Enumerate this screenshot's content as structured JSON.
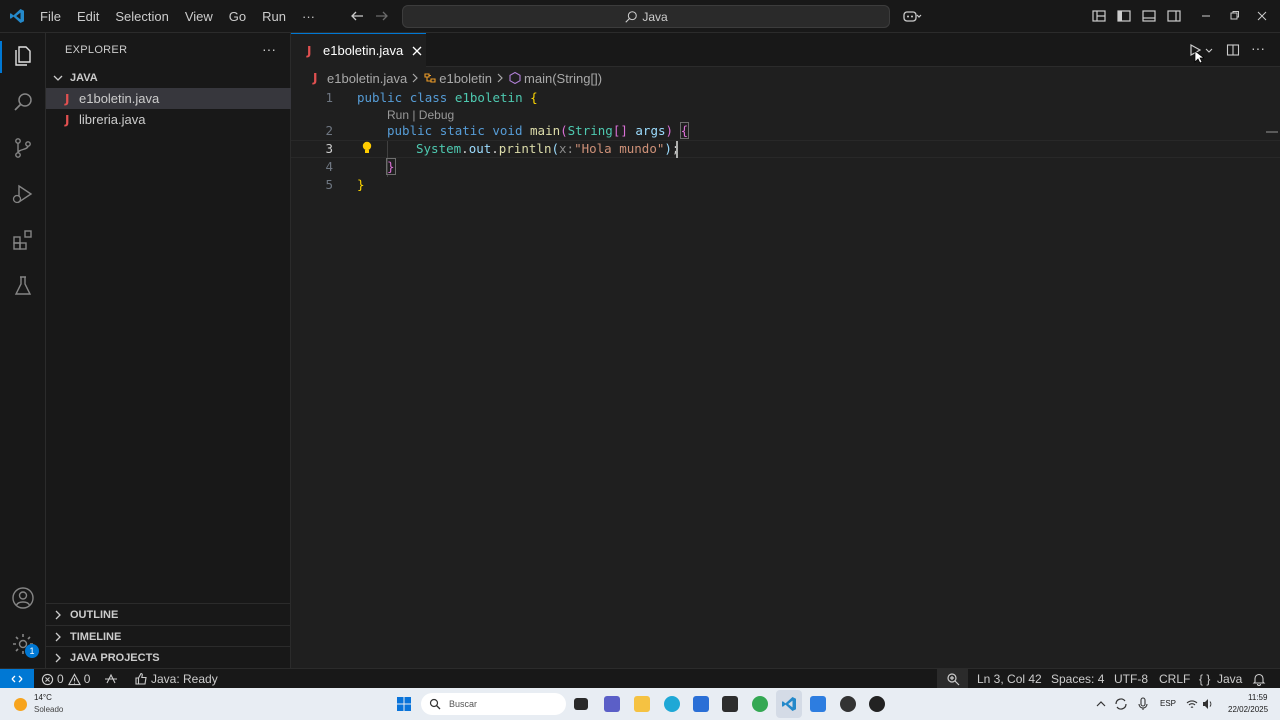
{
  "titlebar": {
    "menu": [
      "File",
      "Edit",
      "Selection",
      "View",
      "Go",
      "Run",
      "···"
    ],
    "search_text": "Java"
  },
  "sidebar": {
    "title": "EXPLORER",
    "more": "···",
    "folder": "JAVA",
    "files": [
      "e1boletin.java",
      "libreria.java"
    ],
    "sections": [
      "OUTLINE",
      "TIMELINE",
      "JAVA PROJECTS"
    ]
  },
  "editor": {
    "tab_label": "e1boletin.java",
    "breadcrumbs": [
      "e1boletin.java",
      "e1boletin",
      "main(String[])"
    ],
    "codelens": "Run | Debug",
    "line_numbers": [
      "1",
      "2",
      "3",
      "4",
      "5"
    ],
    "lines": {
      "l1": {
        "kw1": "public",
        "kw2": "class",
        "name": "e1boletin",
        "brace": "{"
      },
      "l2": {
        "kw1": "public",
        "kw2": "static",
        "kw3": "void",
        "fn": "main",
        "paren": "(",
        "type": "String",
        "arr": "[]",
        "arg": "args",
        "close": ")",
        "brace": "{"
      },
      "l3": {
        "cls": "System",
        "dot1": ".",
        "field": "out",
        "dot2": ".",
        "fn": "println",
        "paren": "(",
        "hint": "x:",
        "str": "\"Hola mundo\"",
        "close": ")",
        "semi": ";"
      },
      "l4": {
        "brace": "}"
      },
      "l5": {
        "brace": "}"
      }
    }
  },
  "statusbar": {
    "errors": "0",
    "warnings": "0",
    "java_status": "Java: Ready",
    "position": "Ln 3, Col 42",
    "spaces": "Spaces: 4",
    "encoding": "UTF-8",
    "eol": "CRLF",
    "language": "Java",
    "badge": "1"
  },
  "taskbar": {
    "weather_temp": "14°C",
    "weather_desc": "Soleado",
    "search_placeholder": "Buscar",
    "lang": "ESP",
    "time": "11:59",
    "date": "22/02/2025"
  },
  "colors": {
    "accent": "#0078d4",
    "editor_bg": "#1f1f1f",
    "sidebar_bg": "#181818",
    "keyword": "#569cd6",
    "class": "#4ec9b0",
    "function": "#dcdcaa",
    "string": "#ce9178"
  }
}
